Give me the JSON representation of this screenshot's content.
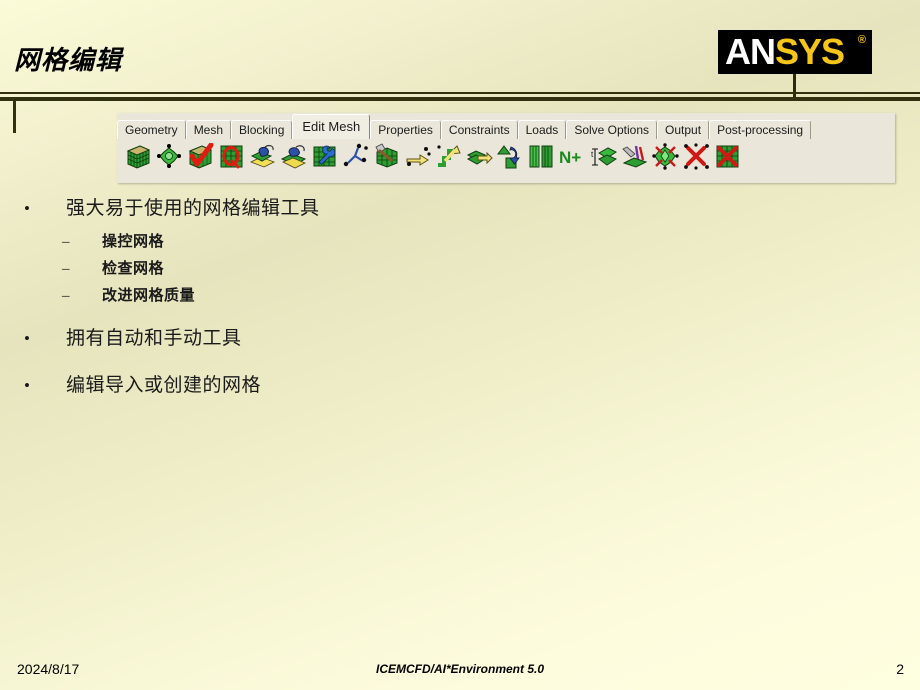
{
  "slide": {
    "title": "网格编辑",
    "logo": {
      "part1": "AN",
      "part2": "SYS",
      "registered": "®",
      "colors": {
        "part1": "#ffffff",
        "part2": "#f5c518",
        "background": "#000000"
      }
    }
  },
  "toolbar": {
    "tabs": [
      {
        "label": "Geometry",
        "active": false
      },
      {
        "label": "Mesh",
        "active": false
      },
      {
        "label": "Blocking",
        "active": false
      },
      {
        "label": "Edit Mesh",
        "active": true
      },
      {
        "label": "Properties",
        "active": false
      },
      {
        "label": "Constraints",
        "active": false
      },
      {
        "label": "Loads",
        "active": false
      },
      {
        "label": "Solve Options",
        "active": false
      },
      {
        "label": "Output",
        "active": false
      },
      {
        "label": "Post-processing",
        "active": false
      }
    ],
    "icons": [
      {
        "name": "display-mesh-icon"
      },
      {
        "name": "mesh-nodes-icon"
      },
      {
        "name": "check-mesh-icon"
      },
      {
        "name": "mesh-quality-icon"
      },
      {
        "name": "smooth-mesh-icon"
      },
      {
        "name": "smooth-mesh-global-icon"
      },
      {
        "name": "repair-mesh-icon"
      },
      {
        "name": "merge-nodes-icon"
      },
      {
        "name": "split-mesh-icon"
      },
      {
        "name": "move-nodes-icon"
      },
      {
        "name": "transform-mesh-icon"
      },
      {
        "name": "extrude-mesh-icon"
      },
      {
        "name": "convert-mesh-type-icon"
      },
      {
        "name": "create-elements-icon"
      },
      {
        "name": "adjust-node-count-icon"
      },
      {
        "name": "renumber-mesh-icon"
      },
      {
        "name": "project-nodes-icon"
      },
      {
        "name": "edit-element-icon"
      },
      {
        "name": "delete-nodes-icon"
      },
      {
        "name": "delete-elements-icon"
      }
    ],
    "colors": {
      "panel_bg": "#eae7da",
      "active_tab_bg": "#f0eee2"
    }
  },
  "content": {
    "bullets": [
      {
        "marker": "•",
        "text": "强大易于使用的网格编辑工具",
        "sub": [
          {
            "marker": "–",
            "text": "操控网格"
          },
          {
            "marker": "–",
            "text": "检查网格"
          },
          {
            "marker": "–",
            "text": "改进网格质量"
          }
        ]
      },
      {
        "marker": "•",
        "text": "拥有自动和手动工具",
        "sub": []
      },
      {
        "marker": "•",
        "text": "编辑导入或创建的网格",
        "sub": []
      }
    ]
  },
  "footer": {
    "date": "2024/8/17",
    "center": "ICEMCFD/AI*Environment 5.0",
    "page": "2"
  }
}
